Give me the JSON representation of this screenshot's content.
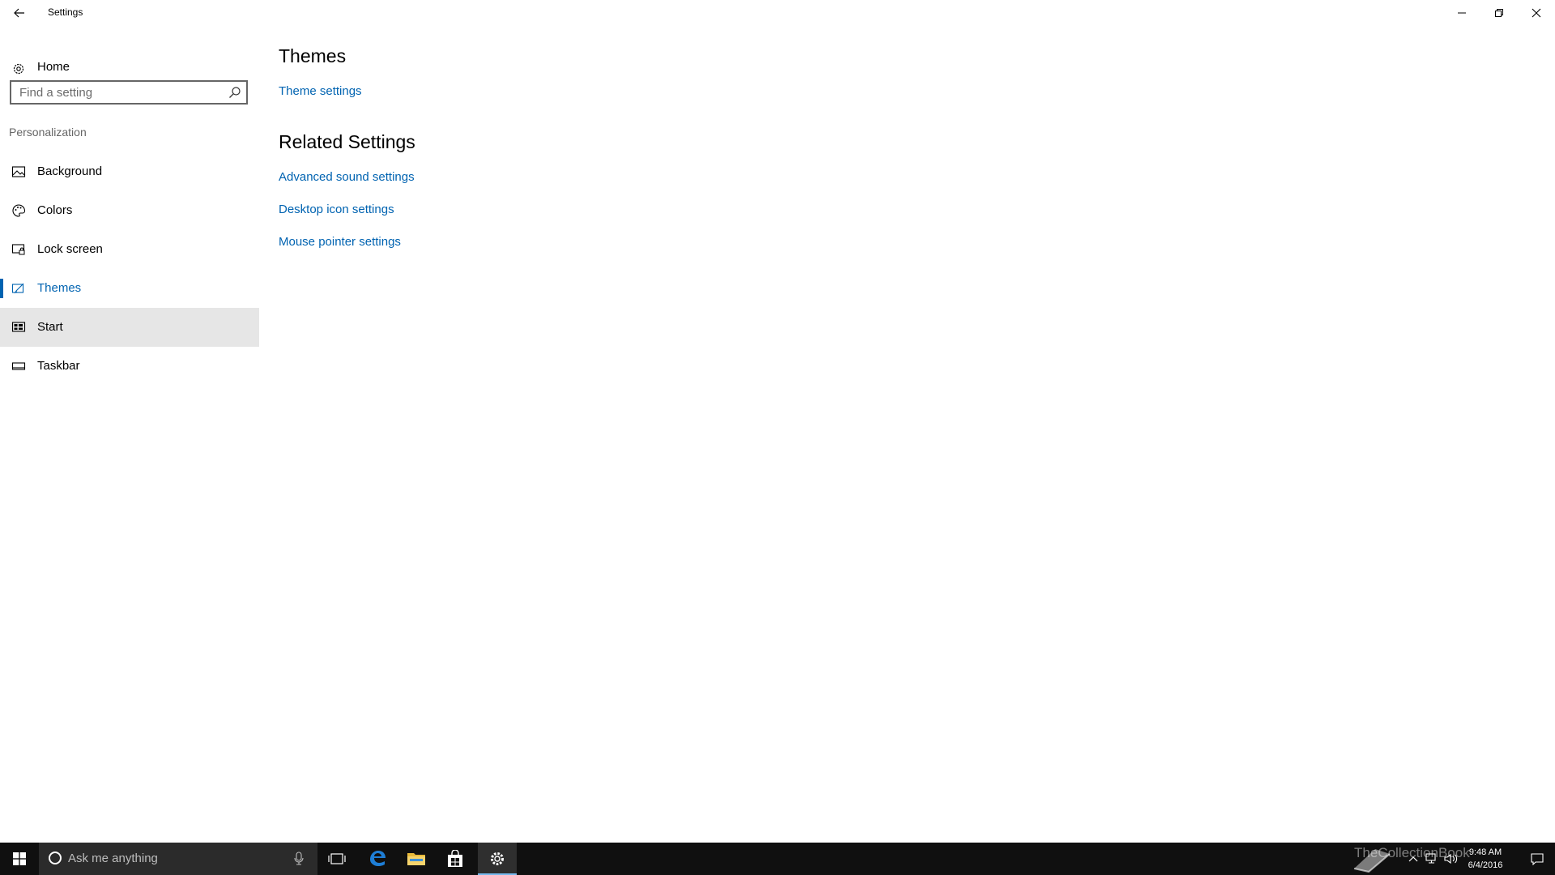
{
  "window": {
    "title": "Settings"
  },
  "sidebar": {
    "home_label": "Home",
    "search_placeholder": "Find a setting",
    "section_label": "Personalization",
    "items": [
      {
        "label": "Background",
        "icon": "picture-icon"
      },
      {
        "label": "Colors",
        "icon": "palette-icon"
      },
      {
        "label": "Lock screen",
        "icon": "lock-screen-icon"
      },
      {
        "label": "Themes",
        "icon": "themes-icon",
        "state": "selected"
      },
      {
        "label": "Start",
        "icon": "start-tiles-icon",
        "state": "hover"
      },
      {
        "label": "Taskbar",
        "icon": "taskbar-icon"
      }
    ]
  },
  "main": {
    "themes_heading": "Themes",
    "theme_settings_link": "Theme settings",
    "related_heading": "Related Settings",
    "related_links": [
      "Advanced sound settings",
      "Desktop icon settings",
      "Mouse pointer settings"
    ]
  },
  "taskbar": {
    "search_text": "Ask me anything",
    "time": "9:48 AM",
    "date": "6/4/2016",
    "watermark": "TheCollectionBook"
  },
  "colors": {
    "accent": "#0063b1",
    "taskbar_bg": "#101010",
    "hover_bg": "#e6e6e6"
  }
}
